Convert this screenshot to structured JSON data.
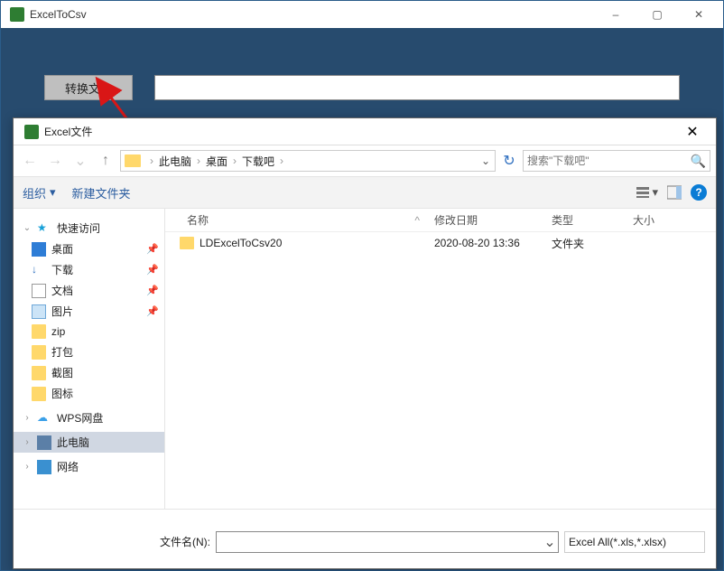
{
  "main": {
    "title": "ExcelToCsv",
    "convert_label": "转换文件"
  },
  "dialog": {
    "title": "Excel文件",
    "breadcrumb": {
      "seg0": "此电脑",
      "seg1": "桌面",
      "seg2": "下载吧"
    },
    "search_placeholder": "搜索\"下载吧\"",
    "toolbar": {
      "organize": "组织",
      "newfolder": "新建文件夹"
    },
    "columns": {
      "name": "名称",
      "date": "修改日期",
      "type": "类型",
      "size": "大小"
    },
    "sidebar": {
      "quick": "快速访问",
      "desktop": "桌面",
      "downloads": "下载",
      "documents": "文档",
      "pictures": "图片",
      "zip": "zip",
      "pack": "打包",
      "shot": "截图",
      "icon": "图标",
      "wps": "WPS网盘",
      "thispc": "此电脑",
      "network": "网络"
    },
    "rows": [
      {
        "name": "LDExcelToCsv20",
        "date": "2020-08-20 13:36",
        "type": "文件夹"
      }
    ],
    "footer": {
      "filename_label": "文件名(N):",
      "filetype": "Excel All(*.xls,*.xlsx)"
    }
  }
}
